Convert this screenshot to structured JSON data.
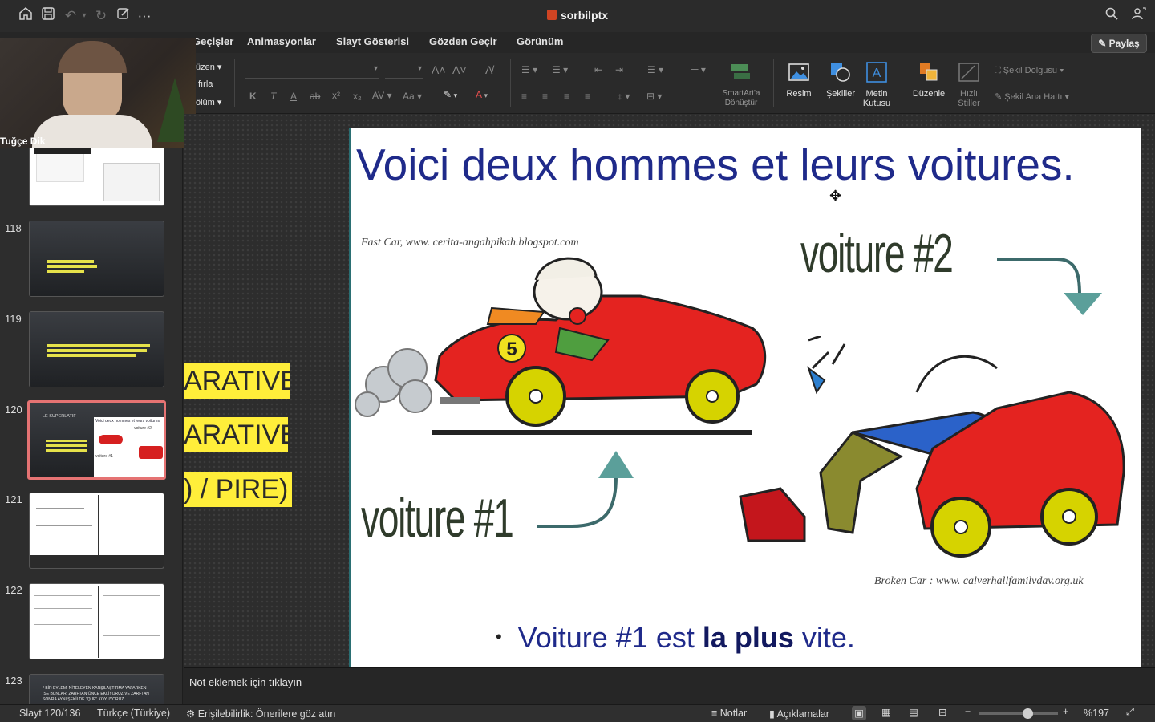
{
  "app": {
    "doc_title": "sorbilptx"
  },
  "tabs": [
    "Geçişler",
    "Animasyonlar",
    "Slayt Gösterisi",
    "Gözden Geçir",
    "Görünüm"
  ],
  "share_label": "Paylaş",
  "ribbon": {
    "left_partial": [
      "üzen",
      "ıfırla",
      "ölüm"
    ],
    "smartart_label": "SmartArt'a Dönüştür",
    "picture_label": "Resim",
    "shapes_label": "Şekiller",
    "textbox_label": "Metin Kutusu",
    "arrange_label": "Düzenle",
    "quick_styles_label": "Hızlı Stiller",
    "shape_fill_label": "Şekil Dolgusu",
    "shape_outline_label": "Şekil Ana Hattı"
  },
  "video": {
    "participant_name": "Tuğçe Dik"
  },
  "thumbnails": [
    {
      "number": "118",
      "style": "dark"
    },
    {
      "number": "119",
      "style": "dark"
    },
    {
      "number": "120",
      "style": "selected",
      "heading": "LE SUPERLATIF",
      "subtitle": "Voici deux hommes et leurs voitures.",
      "tag1": "voiture #2",
      "tag2": "voiture #1"
    },
    {
      "number": "121",
      "style": "light"
    },
    {
      "number": "122",
      "style": "light"
    },
    {
      "number": "123",
      "style": "dark",
      "text": "* BİR EYLEMİ NİTELEYEN KARŞILAŞTIRMA YAPARKEN İSE BUNLARI ZARFTAN ÖNCE EKLİYORUZ VE ZARFTAN SONRA AYNI ŞEKİLDE \"QUE\" KOYUYORUZ"
    }
  ],
  "yellow_boxes": [
    "ARATIVE)",
    "ARATIVE)",
    ") / PIRE)"
  ],
  "slide": {
    "title": "Voici deux hommes et leurs voitures.",
    "credit_fast": "Fast Car,  www. cerita-angahpikah.blogspot.com",
    "voiture2_label": "voiture #2",
    "voiture1_label": "voiture #1",
    "credit_broken": "Broken Car :  www. calverhallfamilvdav.org.uk",
    "car_number": "5",
    "bullet_pre": "Voiture #1 est ",
    "bullet_bold": "la plus",
    "bullet_post": " vite."
  },
  "notes_placeholder": "Not eklemek için tıklayın",
  "status": {
    "slide_counter": "Slayt 120/136",
    "language": "Türkçe (Türkiye)",
    "accessibility": "Erişilebilirlik: Önerilere göz atın",
    "notes_label": "Notlar",
    "comments_label": "Açıklamalar",
    "zoom_label": "%197",
    "zoom_level": 0.62
  }
}
